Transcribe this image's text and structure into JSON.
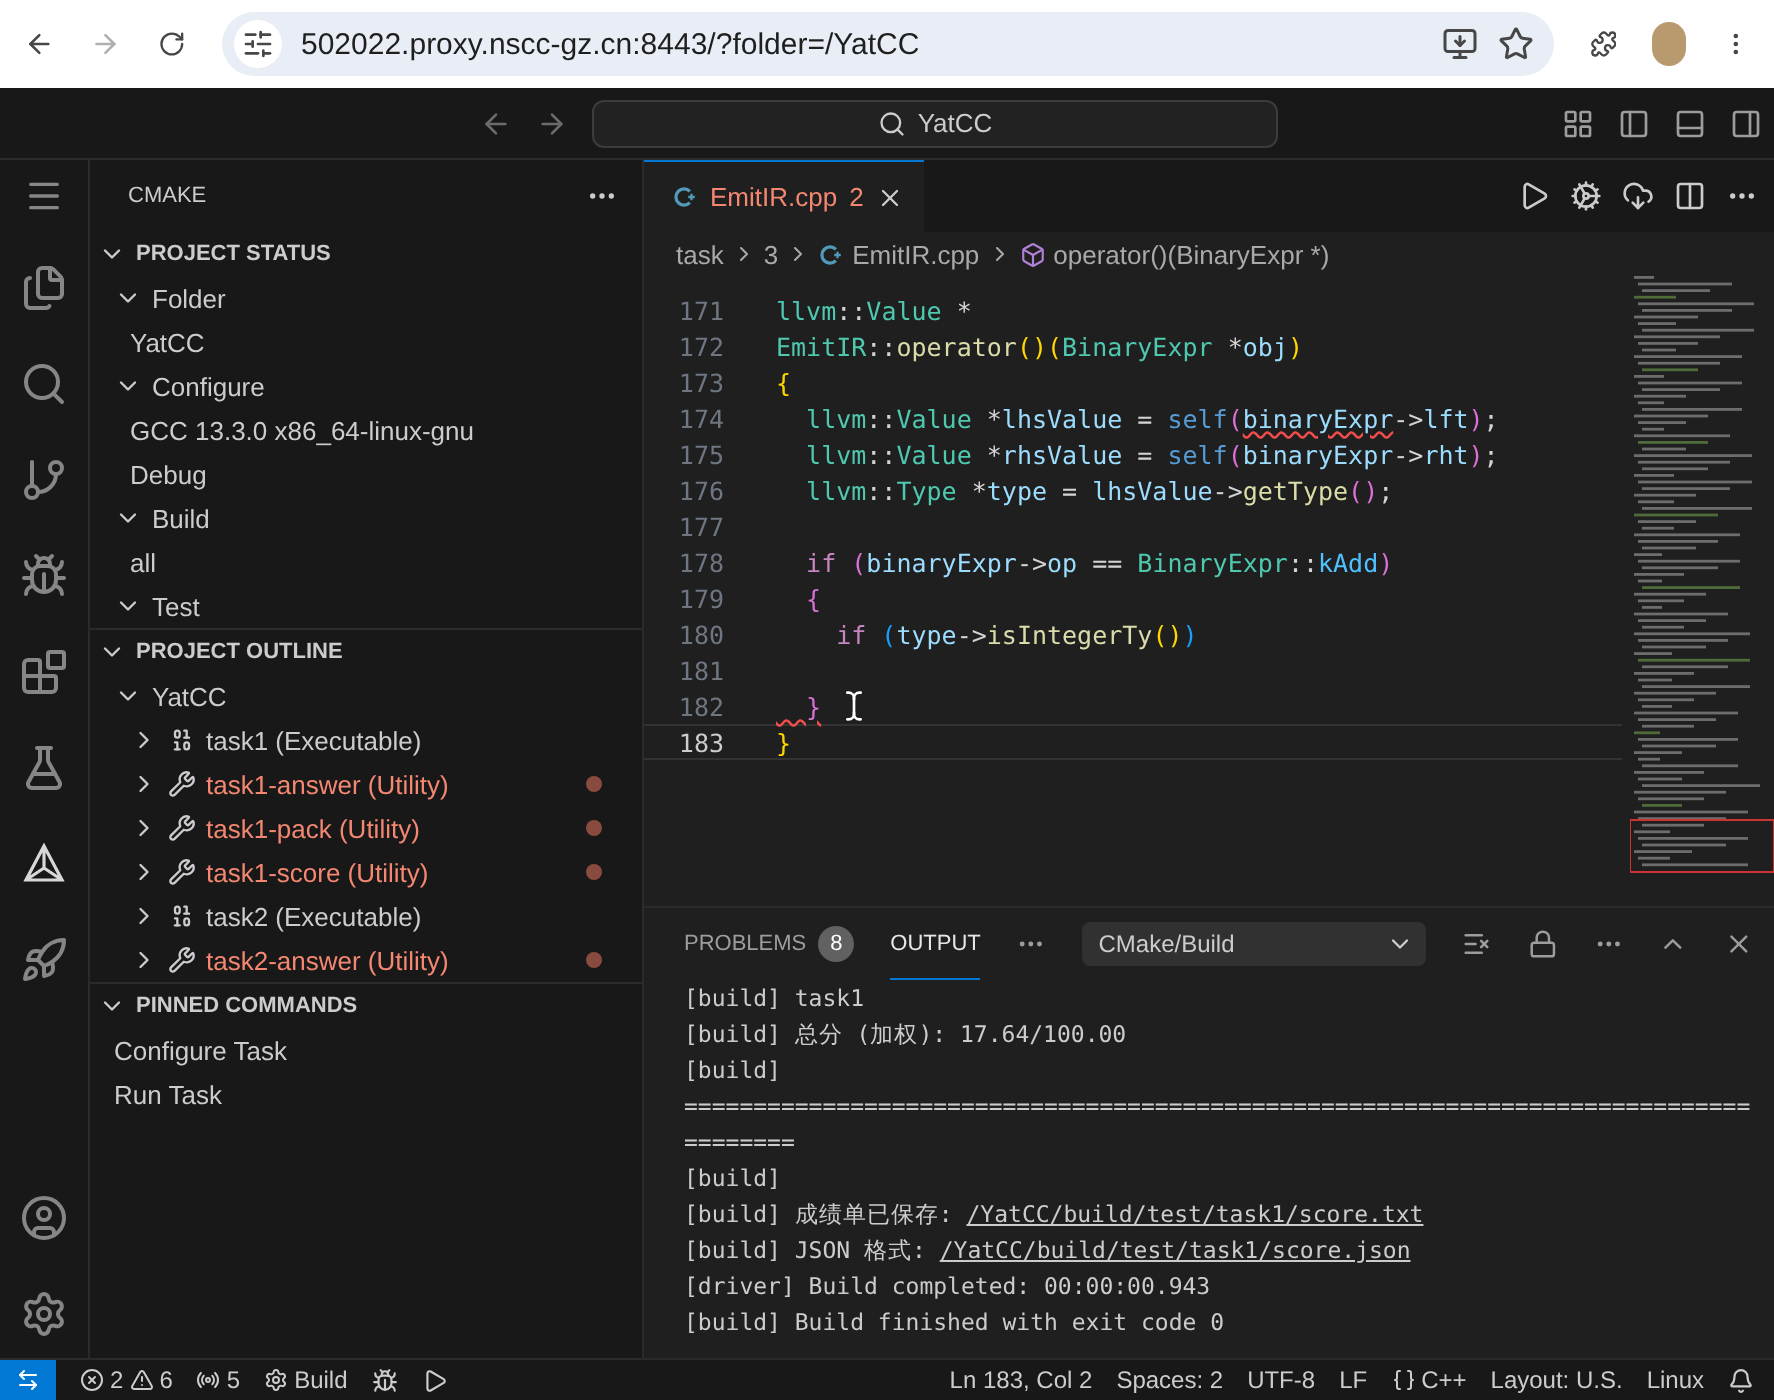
{
  "browser": {
    "url": "502022.proxy.nscc-gz.cn:8443/?folder=/YatCC"
  },
  "titlebar": {
    "search": "YatCC"
  },
  "sidebar": {
    "title": "CMAKE",
    "sections": [
      {
        "title": "PROJECT STATUS",
        "expanded": true,
        "items": [
          {
            "label": "Folder",
            "expanded": true,
            "children": [
              {
                "label": "YatCC"
              }
            ]
          },
          {
            "label": "Configure",
            "expanded": true,
            "children": [
              {
                "label": "GCC 13.3.0 x86_64-linux-gnu"
              },
              {
                "label": "Debug"
              }
            ]
          },
          {
            "label": "Build",
            "expanded": true,
            "children": [
              {
                "label": "all"
              }
            ]
          },
          {
            "label": "Test",
            "expanded": true
          }
        ]
      },
      {
        "title": "PROJECT OUTLINE",
        "expanded": true,
        "items": [
          {
            "label": "YatCC",
            "expanded": true,
            "children": [
              {
                "label": "task1 (Executable)",
                "kind": "executable",
                "expanded": false,
                "modified": false
              },
              {
                "label": "task1-answer (Utility)",
                "kind": "utility",
                "expanded": false,
                "modified": true
              },
              {
                "label": "task1-pack (Utility)",
                "kind": "utility",
                "expanded": false,
                "modified": true
              },
              {
                "label": "task1-score (Utility)",
                "kind": "utility",
                "expanded": false,
                "modified": true
              },
              {
                "label": "task2 (Executable)",
                "kind": "executable",
                "expanded": false,
                "modified": false
              },
              {
                "label": "task2-answer (Utility)",
                "kind": "utility",
                "expanded": false,
                "modified": true
              }
            ]
          }
        ]
      },
      {
        "title": "PINNED COMMANDS",
        "expanded": true,
        "items": [
          {
            "label": "Configure Task"
          },
          {
            "label": "Run Task"
          }
        ]
      }
    ]
  },
  "editor": {
    "tab": {
      "name": "EmitIR.cpp",
      "problems": "2",
      "selected": true
    },
    "breadcrumb": [
      "task",
      "3",
      "EmitIR.cpp",
      "operator()(BinaryExpr *)"
    ],
    "lines": [
      {
        "number": "171",
        "current": false,
        "tokens": [
          {
            "text": "llvm",
            "kind": "type"
          },
          {
            "text": "::",
            "kind": "plain"
          },
          {
            "text": "Value",
            "kind": "type"
          },
          {
            "text": " *",
            "kind": "plain"
          }
        ]
      },
      {
        "number": "172",
        "current": false,
        "tokens": [
          {
            "text": "EmitIR",
            "kind": "type"
          },
          {
            "text": "::",
            "kind": "plain"
          },
          {
            "text": "operator",
            "kind": "fn"
          },
          {
            "text": "()",
            "kind": "bracket1"
          },
          {
            "text": "(",
            "kind": "bracket1"
          },
          {
            "text": "BinaryExpr",
            "kind": "type"
          },
          {
            "text": " *",
            "kind": "plain"
          },
          {
            "text": "obj",
            "kind": "var"
          },
          {
            "text": ")",
            "kind": "bracket1"
          }
        ]
      },
      {
        "number": "173",
        "current": false,
        "tokens": [
          {
            "text": "{",
            "kind": "bracket1"
          }
        ]
      },
      {
        "number": "174",
        "current": false,
        "tokens": [
          {
            "text": "  llvm",
            "kind": "type"
          },
          {
            "text": "::",
            "kind": "plain"
          },
          {
            "text": "Value",
            "kind": "type"
          },
          {
            "text": " *",
            "kind": "plain"
          },
          {
            "text": "lhsValue",
            "kind": "var"
          },
          {
            "text": " = ",
            "kind": "plain"
          },
          {
            "text": "self",
            "kind": "self"
          },
          {
            "text": "(",
            "kind": "bracket2"
          },
          {
            "text": "binaryExpr",
            "kind": "var",
            "squiggle": true
          },
          {
            "text": "->",
            "kind": "plain"
          },
          {
            "text": "lft",
            "kind": "var"
          },
          {
            "text": ")",
            "kind": "bracket2"
          },
          {
            "text": ";",
            "kind": "plain"
          }
        ]
      },
      {
        "number": "175",
        "current": false,
        "tokens": [
          {
            "text": "  llvm",
            "kind": "type"
          },
          {
            "text": "::",
            "kind": "plain"
          },
          {
            "text": "Value",
            "kind": "type"
          },
          {
            "text": " *",
            "kind": "plain"
          },
          {
            "text": "rhsValue",
            "kind": "var"
          },
          {
            "text": " = ",
            "kind": "plain"
          },
          {
            "text": "self",
            "kind": "self"
          },
          {
            "text": "(",
            "kind": "bracket2"
          },
          {
            "text": "binaryExpr",
            "kind": "var"
          },
          {
            "text": "->",
            "kind": "plain"
          },
          {
            "text": "rht",
            "kind": "var"
          },
          {
            "text": ")",
            "kind": "bracket2"
          },
          {
            "text": ";",
            "kind": "plain"
          }
        ]
      },
      {
        "number": "176",
        "current": false,
        "tokens": [
          {
            "text": "  llvm",
            "kind": "type"
          },
          {
            "text": "::",
            "kind": "plain"
          },
          {
            "text": "Type",
            "kind": "type"
          },
          {
            "text": " *",
            "kind": "plain"
          },
          {
            "text": "type",
            "kind": "var"
          },
          {
            "text": " = ",
            "kind": "plain"
          },
          {
            "text": "lhsValue",
            "kind": "var"
          },
          {
            "text": "->",
            "kind": "plain"
          },
          {
            "text": "getType",
            "kind": "fn"
          },
          {
            "text": "()",
            "kind": "bracket2"
          },
          {
            "text": ";",
            "kind": "plain"
          }
        ]
      },
      {
        "number": "177",
        "current": false
      },
      {
        "number": "178",
        "current": false,
        "tokens": [
          {
            "text": "  if",
            "kind": "kw"
          },
          {
            "text": " (",
            "kind": "bracket2"
          },
          {
            "text": "binaryExpr",
            "kind": "var"
          },
          {
            "text": "->",
            "kind": "plain"
          },
          {
            "text": "op",
            "kind": "var"
          },
          {
            "text": " == ",
            "kind": "plain"
          },
          {
            "text": "BinaryExpr",
            "kind": "type"
          },
          {
            "text": "::",
            "kind": "plain"
          },
          {
            "text": "kAdd",
            "kind": "const"
          },
          {
            "text": ")",
            "kind": "bracket2"
          }
        ]
      },
      {
        "number": "179",
        "current": false,
        "tokens": [
          {
            "text": "  {",
            "kind": "bracket2"
          }
        ]
      },
      {
        "number": "180",
        "current": false,
        "tokens": [
          {
            "text": "    if",
            "kind": "kw"
          },
          {
            "text": " (",
            "kind": "bracket3"
          },
          {
            "text": "type",
            "kind": "var"
          },
          {
            "text": "->",
            "kind": "plain"
          },
          {
            "text": "isIntegerTy",
            "kind": "fn"
          },
          {
            "text": "()",
            "kind": "bracket1"
          },
          {
            "text": ")",
            "kind": "bracket3"
          }
        ]
      },
      {
        "number": "181",
        "current": false
      },
      {
        "number": "182",
        "current": false,
        "tokens": [
          {
            "text": "  }",
            "kind": "bracket2",
            "squiggle": true
          }
        ]
      },
      {
        "number": "183",
        "current": true,
        "tokens": [
          {
            "text": "}",
            "kind": "bracket1"
          }
        ]
      }
    ]
  },
  "panel": {
    "tabs": [
      {
        "label": "PROBLEMS",
        "badge": "8",
        "selected": false
      },
      {
        "label": "OUTPUT",
        "selected": true
      }
    ],
    "channel": "CMake/Build",
    "lines": [
      {
        "text": "[build] task1"
      },
      {
        "text": "[build] 总分 (加权): 17.64/100.00"
      },
      {
        "text": "[build]"
      },
      {
        "text": "====================================================================================="
      },
      {
        "text": "[build]"
      },
      {
        "text": "[build] 成绩单已保存: ",
        "link": "/YatCC/build/test/task1/score.txt"
      },
      {
        "text": "[build] JSON 格式: ",
        "link": "/YatCC/build/test/task1/score.json"
      },
      {
        "text": "[driver] Build completed: 00:00:00.943"
      },
      {
        "text": "[build] Build finished with exit code 0"
      }
    ]
  },
  "status_bar": {
    "errors": "2",
    "warnings": "6",
    "ports": "5",
    "build": "Build",
    "right": [
      "Ln 183, Col 2",
      "Spaces: 2",
      "UTF-8",
      "LF",
      "C++",
      "Layout: U.S.",
      "Linux"
    ]
  }
}
